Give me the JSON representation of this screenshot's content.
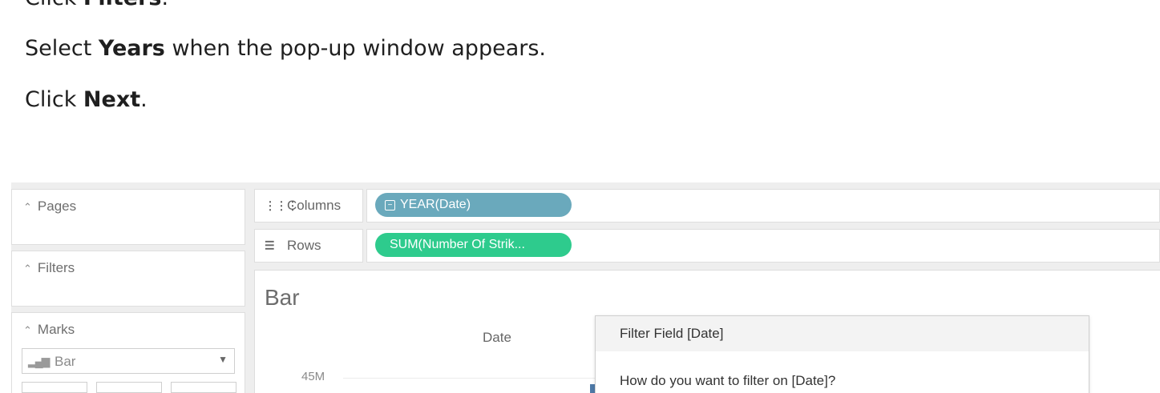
{
  "instructions": [
    {
      "pre": "Click ",
      "bold": "Filters",
      "post": "."
    },
    {
      "pre": "Select ",
      "bold": "Years",
      "post": " when the pop-up window appears."
    },
    {
      "pre": "Click ",
      "bold": "Next",
      "post": "."
    }
  ],
  "screenshot": {
    "side_panels": {
      "pages": {
        "title": "Pages",
        "icon": "chevron-up-icon"
      },
      "filters": {
        "title": "Filters",
        "icon": "chevron-up-icon"
      },
      "marks": {
        "title": "Marks",
        "icon": "chevron-up-icon",
        "mark_type": "Bar",
        "mark_type_icon": "bar-chart-icon"
      }
    },
    "shelves": {
      "columns": {
        "label": "Columns",
        "icon": "columns-icon",
        "pill": "YEAR(Date)",
        "pill_color": "#6aa9bc"
      },
      "rows": {
        "label": "Rows",
        "icon": "rows-icon",
        "pill": "SUM(Number Of Strik...",
        "pill_color": "#2ecb8d"
      }
    },
    "view": {
      "title": "Bar",
      "column_header": "Date",
      "y_tick": "45M"
    },
    "dialog": {
      "title": "Filter Field [Date]",
      "question": "How do you want to filter on [Date]?"
    }
  }
}
